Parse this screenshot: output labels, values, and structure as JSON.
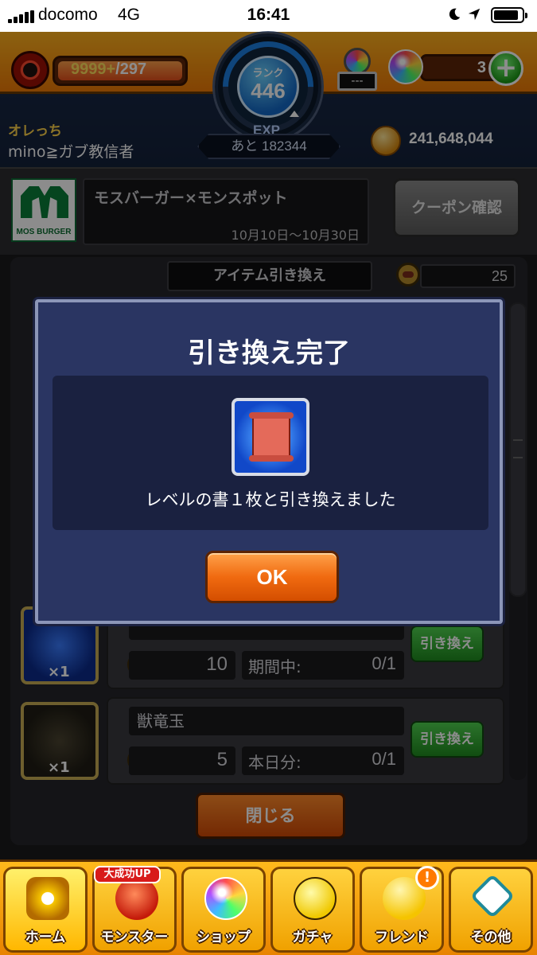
{
  "status_bar": {
    "carrier": "docomo",
    "network": "4G",
    "time": "16:41"
  },
  "header": {
    "stamina_current": "9999+",
    "stamina_max": "/297",
    "stamina_fill_fraction": 1.0,
    "rank_label": "ランク",
    "rank_value": "446",
    "exp_label": "EXP",
    "exp_remaining": "あと 182344",
    "tool_slot_value": "---",
    "orb_count": "3",
    "player_tag": "オレっち",
    "player_name": "mino≧ガブ教信者",
    "gold": "241,648,044"
  },
  "banner": {
    "logo_text": "MOS BURGER",
    "title": "モスバーガー×モンスポット",
    "dates": "10月10日〜10月30日",
    "coupon_button": "クーポン確認"
  },
  "list": {
    "heading": "アイテム引き換え",
    "meat_count": "25",
    "items": [
      {
        "name": "",
        "qty": "×1",
        "cost": "10",
        "limit_label": "期間中:",
        "limit_value": "0/1",
        "button": "引き換え"
      },
      {
        "name": "獣竜玉",
        "qty": "×1",
        "cost": "5",
        "limit_label": "本日分:",
        "limit_value": "0/1",
        "button": "引き換え"
      }
    ],
    "close_button": "閉じる"
  },
  "modal": {
    "title": "引き換え完了",
    "message": "レベルの書１枚と引き換えました",
    "ok_button": "OK"
  },
  "bottom_nav": {
    "badge": "大成功UP",
    "alert": "!",
    "tabs": [
      {
        "label": "ホーム",
        "icon": "home-icon"
      },
      {
        "label": "モンスター",
        "icon": "monster-icon"
      },
      {
        "label": "ショップ",
        "icon": "shop-orb-icon"
      },
      {
        "label": "ガチャ",
        "icon": "gacha-egg-icon"
      },
      {
        "label": "フレンド",
        "icon": "friend-icon"
      },
      {
        "label": "その他",
        "icon": "other-icon"
      }
    ]
  }
}
